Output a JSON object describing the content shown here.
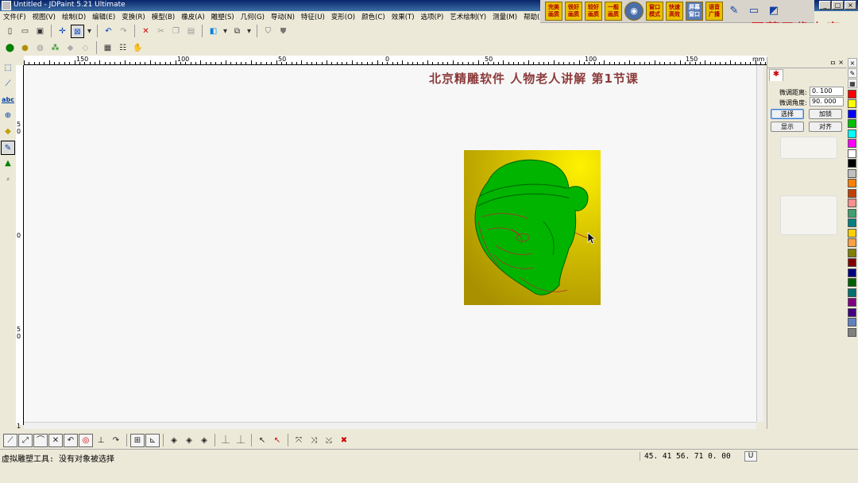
{
  "window": {
    "title": "Untitled - JDPaint 5.21 Ultimate",
    "controls": [
      "_",
      "□",
      "×"
    ]
  },
  "menu": [
    "文件(F)",
    "视图(V)",
    "绘制(D)",
    "编辑(E)",
    "变换(R)",
    "模型(B)",
    "橡皮(A)",
    "雕塑(S)",
    "几何(G)",
    "导动(N)",
    "特征(U)",
    "变形(O)",
    "颜色(C)",
    "效果(T)",
    "选项(P)",
    "艺术绘制(Y)",
    "测量(M)",
    "帮助(H)"
  ],
  "quickbar": {
    "buttons": [
      "完美画质",
      "很好画质",
      "较好画质",
      "一般画质",
      "◉",
      "窗口模式",
      "快速高效",
      "屏幕窗口",
      "语音广播"
    ],
    "extra_icons": [
      "pen-icon",
      "screen-icon",
      "close-window-icon"
    ]
  },
  "watermark": "屏幕录像专家",
  "overlay_title": "北京精雕软件 人物老人讲解 第1节课",
  "rulers": {
    "horizontal_labels": [
      "150",
      "100",
      "50",
      "0",
      "50",
      "100",
      "150",
      "mm"
    ],
    "vertical_labels": [
      "5\n0",
      "0",
      "5\n0",
      "1"
    ]
  },
  "panel": {
    "pin": "ㅁ",
    "close": "×",
    "tab_icon": "✱",
    "fields": [
      {
        "label": "微调距离:",
        "value": "0. 100"
      },
      {
        "label": "微调角度:",
        "value": "90. 000"
      }
    ],
    "buttons": {
      "select": "选择",
      "lock": "加锁",
      "show": "显示",
      "align": "对齐"
    }
  },
  "palette": {
    "colors": [
      "#ff0000",
      "#ffff00",
      "#0000ff",
      "#00c000",
      "#00ffff",
      "#ff00ff",
      "#ffffff",
      "#000000",
      "#c0c0c0",
      "#ff8000",
      "#c04000",
      "#ff9090",
      "#40a070",
      "#008080",
      "#ffd000",
      "#ffa040",
      "#808000",
      "#800000",
      "#000080",
      "#006000",
      "#007070",
      "#800080",
      "#400080",
      "#6080c0",
      "#808080"
    ]
  },
  "status": {
    "message": "虚拟雕塑工具: 没有对象被选择",
    "coords": "45. 41  56. 71  0. 00",
    "unit": "U"
  },
  "colors": {
    "title_text": "#8b3a3a",
    "watermark": "#d01818",
    "art_face": "#00b000",
    "art_bg": "#b8a000"
  }
}
